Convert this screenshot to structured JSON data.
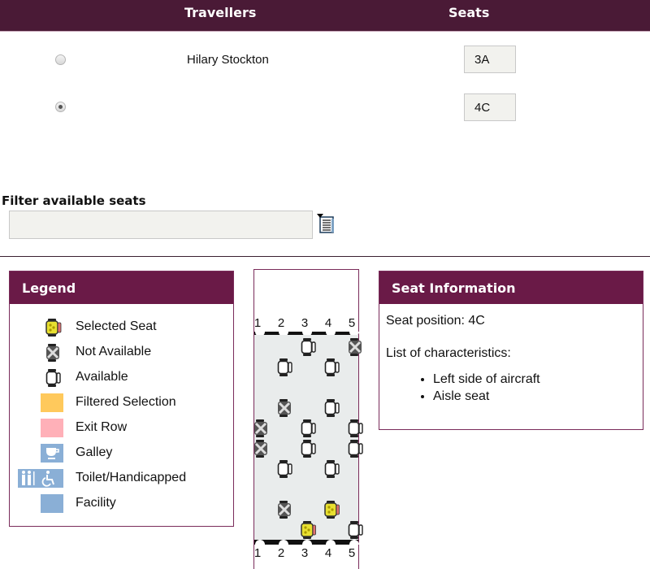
{
  "header": {
    "travellers_label": "Travellers",
    "seats_label": "Seats"
  },
  "travellers": [
    {
      "name": "Hilary Stockton",
      "seat": "3A",
      "selected": false
    },
    {
      "name": "",
      "seat": "4C",
      "selected": true
    }
  ],
  "filter": {
    "label": "Filter available seats",
    "value": "",
    "icon": "filter-list-icon"
  },
  "legend": {
    "title": "Legend",
    "items": [
      {
        "label": "Selected Seat",
        "icon": "selected-seat-icon"
      },
      {
        "label": "Not Available",
        "icon": "not-available-seat-icon"
      },
      {
        "label": "Available",
        "icon": "available-seat-icon"
      },
      {
        "label": "Filtered Selection",
        "icon": "filtered-selection-swatch",
        "color": "#ffc95c"
      },
      {
        "label": "Exit Row",
        "icon": "exit-row-swatch",
        "color": "#ffb0b8"
      },
      {
        "label": "Galley",
        "icon": "galley-icon",
        "color": "#8aafd6"
      },
      {
        "label": "Toilet/Handicapped",
        "icon": "toilet-handicapped-icon",
        "color": "#8aafd6"
      },
      {
        "label": "Facility",
        "icon": "facility-swatch",
        "color": "#8aafd6"
      }
    ]
  },
  "seatmap": {
    "columns": [
      "1",
      "2",
      "3",
      "4",
      "5"
    ],
    "seats": [
      {
        "col": 3,
        "row": 0,
        "status": "available"
      },
      {
        "col": 5,
        "row": 0,
        "status": "unavailable"
      },
      {
        "col": 2,
        "row": 1,
        "status": "available"
      },
      {
        "col": 4,
        "row": 1,
        "status": "available"
      },
      {
        "col": 2,
        "row": 3,
        "status": "unavailable"
      },
      {
        "col": 4,
        "row": 3,
        "status": "available"
      },
      {
        "col": 1,
        "row": 4,
        "status": "unavailable"
      },
      {
        "col": 3,
        "row": 4,
        "status": "available"
      },
      {
        "col": 5,
        "row": 4,
        "status": "available"
      },
      {
        "col": 1,
        "row": 5,
        "status": "unavailable"
      },
      {
        "col": 3,
        "row": 5,
        "status": "available"
      },
      {
        "col": 5,
        "row": 5,
        "status": "available"
      },
      {
        "col": 2,
        "row": 6,
        "status": "available"
      },
      {
        "col": 4,
        "row": 6,
        "status": "available"
      },
      {
        "col": 2,
        "row": 8,
        "status": "unavailable"
      },
      {
        "col": 4,
        "row": 8,
        "status": "selected"
      },
      {
        "col": 3,
        "row": 9,
        "status": "selected"
      },
      {
        "col": 5,
        "row": 9,
        "status": "available"
      }
    ]
  },
  "seat_info": {
    "title": "Seat Information",
    "position_label": "Seat position: 4C",
    "characteristics_label": "List of characteristics:",
    "characteristics": [
      "Left side of aircraft",
      "Aisle seat"
    ]
  },
  "colors": {
    "header_bg": "#4a1a36",
    "panel_header_bg": "#6a1a47",
    "panel_border": "#7a2b5a",
    "cabin_bg": "#e9ecec"
  }
}
